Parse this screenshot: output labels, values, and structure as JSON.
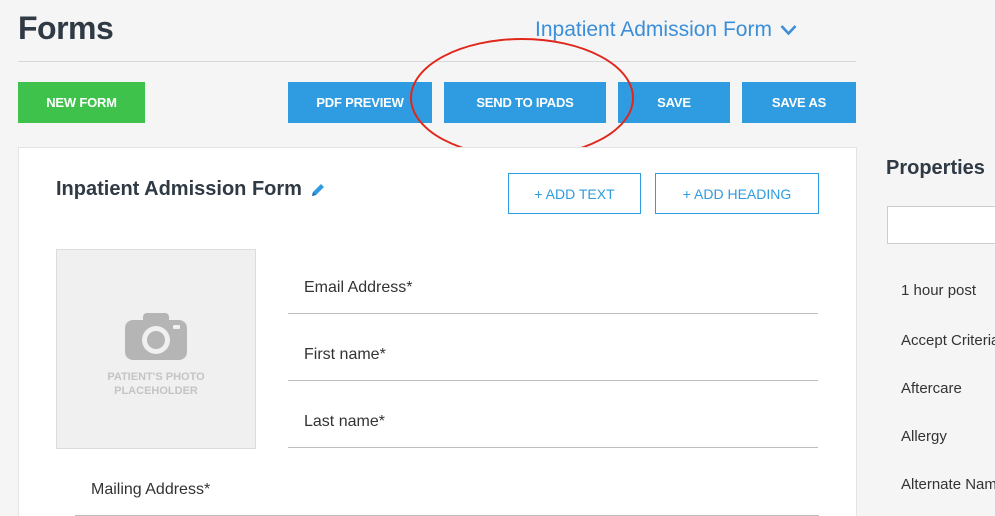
{
  "header": {
    "title": "Forms",
    "form_selector": "Inpatient Admission Form"
  },
  "toolbar": {
    "new_form": "NEW FORM",
    "pdf_preview": "PDF PREVIEW",
    "send_to_ipads": "SEND TO IPADS",
    "save": "SAVE",
    "save_as": "SAVE AS"
  },
  "form": {
    "name": "Inpatient Admission Form",
    "add_text": "+ ADD TEXT",
    "add_heading": "+ ADD HEADING",
    "photo_placeholder": "PATIENT'S PHOTO PLACEHOLDER",
    "fields": [
      "Email Address*",
      "First name*",
      "Last name*",
      "Mailing Address*"
    ]
  },
  "sidebar": {
    "title": "Properties",
    "search_value": "",
    "items": [
      "1 hour post",
      "Accept Criteria",
      "Aftercare",
      "Allergy",
      "Alternate Name"
    ]
  },
  "colors": {
    "accent_blue": "#2f9be0",
    "green": "#3fc24c",
    "highlight_red": "#e0271a"
  }
}
